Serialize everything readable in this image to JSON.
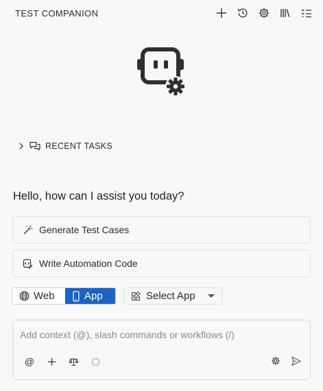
{
  "header": {
    "title": "TEST COMPANION",
    "actions": [
      {
        "name": "new-chat",
        "icon": "plus-icon"
      },
      {
        "name": "history",
        "icon": "history-icon"
      },
      {
        "name": "settings",
        "icon": "gear-icon"
      },
      {
        "name": "library",
        "icon": "library-icon"
      },
      {
        "name": "tasks",
        "icon": "checklist-icon"
      }
    ]
  },
  "logo": {
    "icon": "robot-gear-icon"
  },
  "recent_tasks": {
    "label": "RECENT TASKS",
    "expanded": false
  },
  "greeting": "Hello, how can I assist you today?",
  "actions": [
    {
      "label": "Generate Test Cases",
      "icon": "magic-wand-icon"
    },
    {
      "label": "Write Automation Code",
      "icon": "code-edit-icon"
    }
  ],
  "mode_toggle": {
    "options": [
      {
        "label": "Web",
        "icon": "globe-icon",
        "selected": false
      },
      {
        "label": "App",
        "icon": "mobile-icon",
        "selected": true
      }
    ]
  },
  "select_app": {
    "label": "Select App",
    "icon": "apps-icon"
  },
  "composer": {
    "placeholder": "Add context (@), slash commands or workflows (/)",
    "value": "",
    "tools": [
      {
        "name": "mention",
        "glyph": "@"
      },
      {
        "name": "add",
        "icon": "plus-icon"
      },
      {
        "name": "balance",
        "icon": "scale-icon"
      },
      {
        "name": "status",
        "icon": "circle-icon"
      }
    ]
  },
  "colors": {
    "accent": "#1b64c5",
    "background": "#f8f8f8",
    "border": "#e0e0e0"
  }
}
